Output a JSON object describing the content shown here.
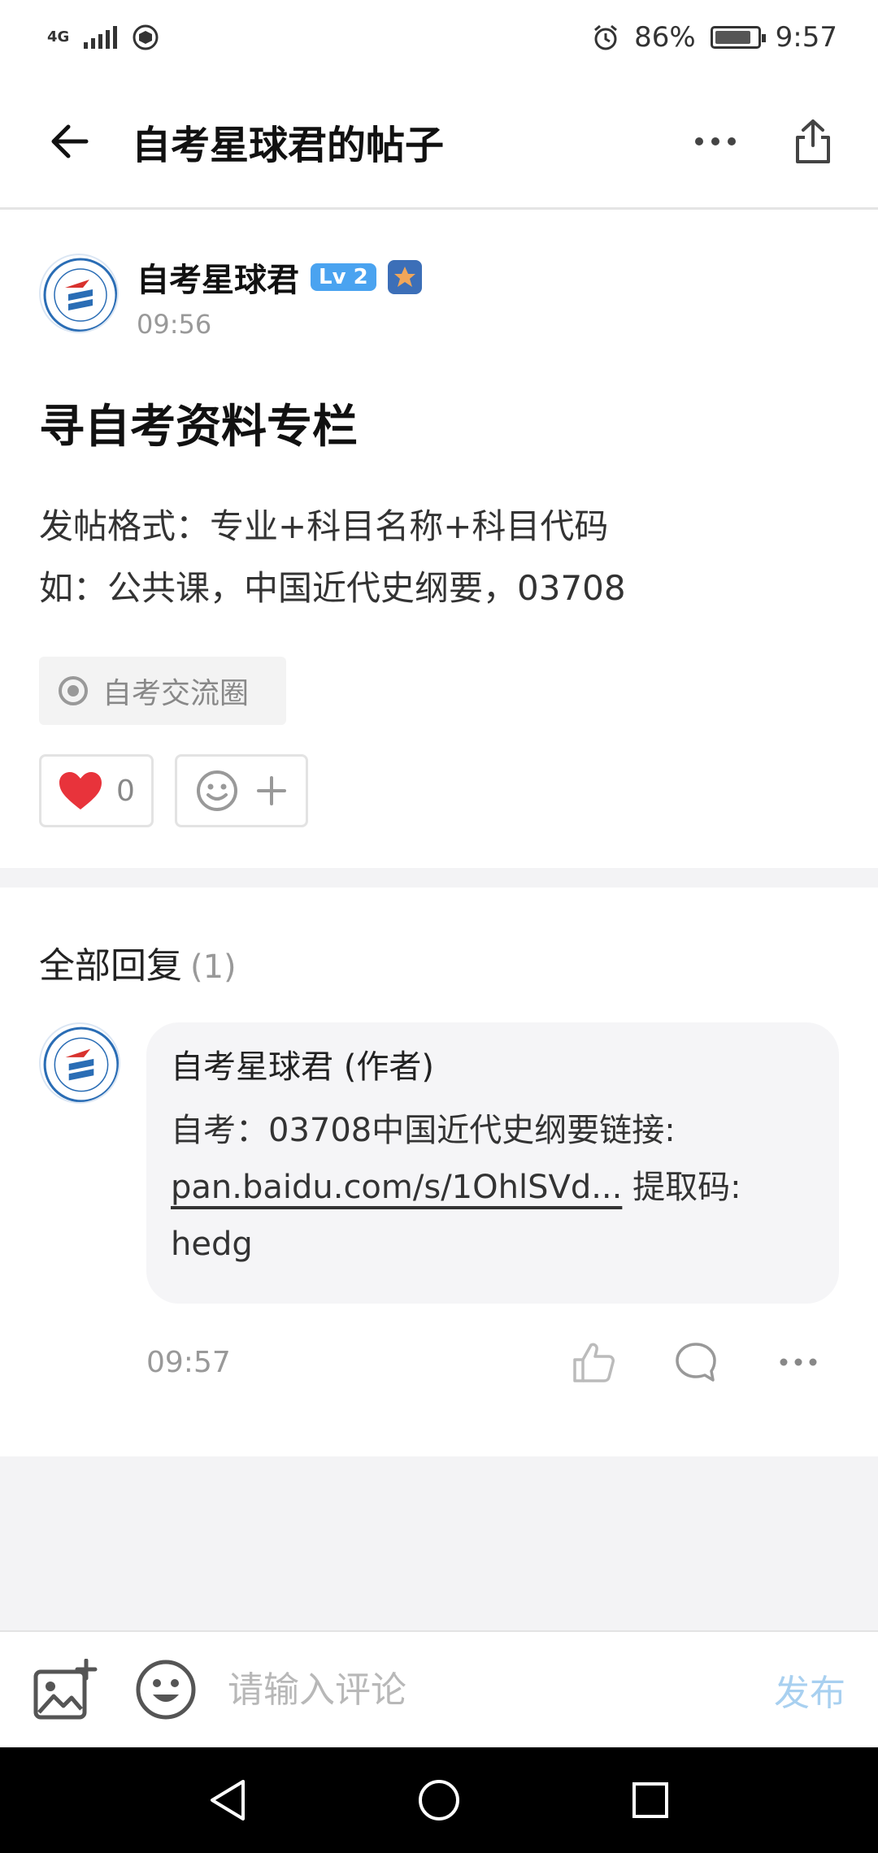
{
  "status_bar": {
    "network": "4G",
    "battery": "86%",
    "battery_level": 0.86,
    "time": "9:57"
  },
  "app_bar": {
    "title": "自考星球君的帖子"
  },
  "post": {
    "author": "自考星球君",
    "level": "Lv 2",
    "time": "09:56",
    "title": "寻自考资料专栏",
    "body_line1": "发帖格式：专业+科目名称+科目代码",
    "body_line2": "如：公共课，中国近代史纲要，03708",
    "circle_tag": "自考交流圈",
    "like_count": "0"
  },
  "replies": {
    "header": "全部回复",
    "count": "(1)",
    "items": [
      {
        "author": "自考星球君 (作者)",
        "text_prefix": "自考：03708中国近代史纲要链接:",
        "link": "pan.baidu.com/s/1OhlSVd...",
        "text_suffix": " 提取码:",
        "code": "hedg",
        "time": "09:57"
      }
    ]
  },
  "comment_bar": {
    "placeholder": "请输入评论",
    "publish": "发布"
  },
  "colors": {
    "accent": "#4aa3f0",
    "publish_disabled": "#a8d0f0",
    "like_red": "#e8333b",
    "separator": "#f3f3f5"
  },
  "icons": [
    "back-arrow-icon",
    "more-icon",
    "share-icon",
    "star-icon",
    "circle-icon",
    "heart-icon",
    "emoji-icon",
    "plus-icon",
    "thumb-up-icon",
    "comment-icon",
    "image-add-icon",
    "nav-back-icon",
    "nav-home-icon",
    "nav-recents-icon"
  ]
}
